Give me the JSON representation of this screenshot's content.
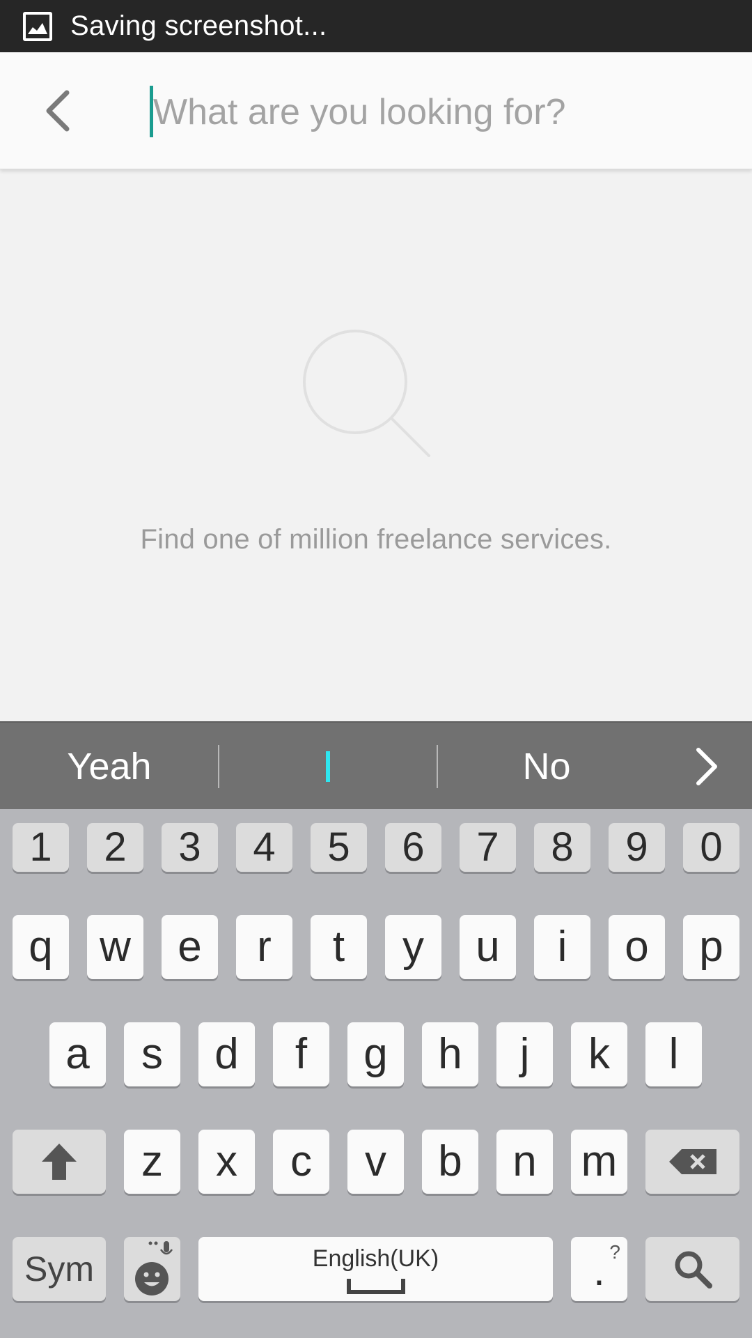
{
  "status_bar": {
    "text": "Saving screenshot..."
  },
  "search": {
    "placeholder": "What are you looking for?",
    "value": ""
  },
  "empty_state": {
    "message": "Find one of million freelance services."
  },
  "suggestions": [
    "Yeah",
    "No"
  ],
  "keyboard": {
    "numbers": [
      "1",
      "2",
      "3",
      "4",
      "5",
      "6",
      "7",
      "8",
      "9",
      "0"
    ],
    "row1": [
      "q",
      "w",
      "e",
      "r",
      "t",
      "y",
      "u",
      "i",
      "o",
      "p"
    ],
    "row2": [
      "a",
      "s",
      "d",
      "f",
      "g",
      "h",
      "j",
      "k",
      "l"
    ],
    "row3": [
      "z",
      "x",
      "c",
      "v",
      "b",
      "n",
      "m"
    ],
    "sym_label": "Sym",
    "space_label": "English(UK)",
    "period_label": ".",
    "period_alt": "?"
  },
  "colors": {
    "accent": "#1a9c8f",
    "keyboard_bg": "#b5b6ba",
    "suggest_bg": "#717171"
  }
}
